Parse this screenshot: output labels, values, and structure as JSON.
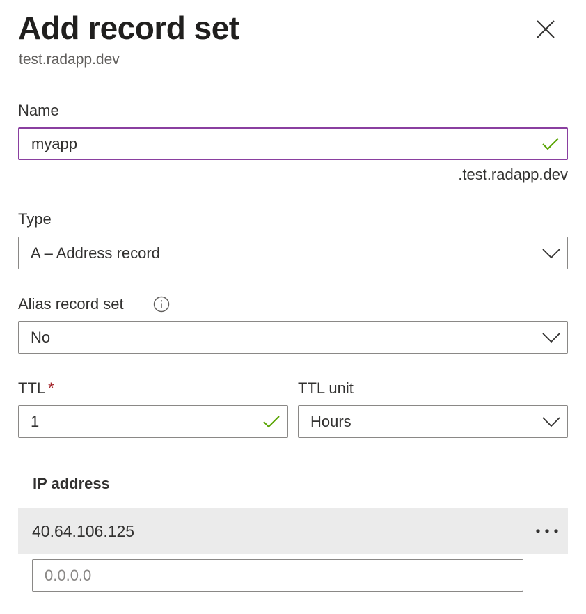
{
  "panel": {
    "title": "Add record set",
    "subtitle": "test.radapp.dev",
    "close_icon": "close-icon"
  },
  "form": {
    "name": {
      "label": "Name",
      "value": "myapp",
      "valid_icon": "checkmark-icon",
      "suffix": ".test.radapp.dev"
    },
    "type": {
      "label": "Type",
      "value": "A – Address record",
      "icon": "chevron-down-icon"
    },
    "alias": {
      "label": "Alias record set",
      "info_icon": "info-icon",
      "value": "No",
      "icon": "chevron-down-icon"
    },
    "ttl": {
      "label": "TTL",
      "required_marker": "*",
      "value": "1",
      "valid_icon": "checkmark-icon"
    },
    "ttl_unit": {
      "label": "TTL unit",
      "value": "Hours",
      "icon": "chevron-down-icon"
    }
  },
  "ip_section": {
    "header": "IP address",
    "rows": [
      {
        "value": "40.64.106.125",
        "more_icon": "more-icon"
      }
    ],
    "new_placeholder": "0.0.0.0"
  },
  "colors": {
    "focus_border": "#8a3fa0",
    "valid_check": "#57a300",
    "required": "#a4262c",
    "row_bg": "#ebebeb"
  }
}
